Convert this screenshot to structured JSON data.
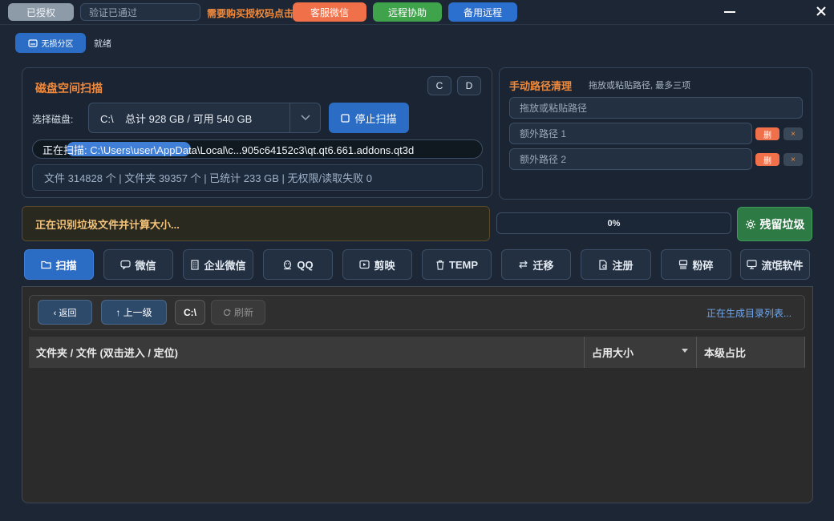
{
  "topbar": {
    "authorized_label": "已授权",
    "verify_placeholder": "验证已通过",
    "buy_hint": "需要购买授权码点击",
    "customer_service_label": "客服微信",
    "remote_assist_label": "远程协助",
    "backup_remote_label": "备用远程"
  },
  "toolbar": {
    "partition_label": "无损分区",
    "status": "就绪"
  },
  "scan_panel": {
    "title": "磁盘空间扫描",
    "drive_c_label": "C",
    "drive_d_label": "D",
    "select_label": "选择磁盘:",
    "selected_disk": "C:\\    总计 928 GB / 可用 540 GB",
    "stop_label": "停止扫描",
    "scanning_path": "正在扫描: C:\\Users\\user\\AppData\\Local\\c...905c64152c3\\qt.qt6.661.addons.qt3d",
    "stats": "文件 314828 个 | 文件夹 39357 个 | 已统计 233 GB | 无权限/读取失败 0"
  },
  "path_panel": {
    "title": "手动路径清理",
    "hint": "拖放或粘贴路径, 最多三项",
    "main_placeholder": "拖放或粘贴路径",
    "extra_1_placeholder": "额外路径 1",
    "extra_2_placeholder": "额外路径 2",
    "delete_label": "删",
    "clear_label": "×"
  },
  "status_row": {
    "junk_status": "正在识别垃圾文件并计算大小...",
    "progress_text": "0%",
    "progress": 0,
    "residual_label": "残留垃圾"
  },
  "categories": [
    {
      "label": "扫描",
      "icon": "folder-icon"
    },
    {
      "label": "微信",
      "icon": "chat-icon"
    },
    {
      "label": "企业微信",
      "icon": "building-icon"
    },
    {
      "label": "QQ",
      "icon": "penguin-icon"
    },
    {
      "label": "剪映",
      "icon": "video-icon"
    },
    {
      "label": "TEMP",
      "icon": "trash-icon"
    },
    {
      "label": "迁移",
      "icon": "transfer-icon"
    },
    {
      "label": "注册",
      "icon": "registry-icon"
    },
    {
      "label": "粉碎",
      "icon": "shredder-icon"
    },
    {
      "label": "流氓软件",
      "icon": "monitor-icon"
    }
  ],
  "browser": {
    "back_label": "‹ 返回",
    "up_label": "↑ 上一级",
    "drive_label": "C:\\",
    "refresh_label": "刷新",
    "status": "正在生成目录列表...",
    "columns": [
      "文件夹 / 文件 (双击进入 / 定位)",
      "占用大小",
      "本级占比"
    ]
  },
  "colors": {
    "accent_orange": "#f08a3c",
    "primary_blue": "#2b6cc4",
    "success_green": "#3ea34a",
    "danger_red": "#f0704a"
  }
}
